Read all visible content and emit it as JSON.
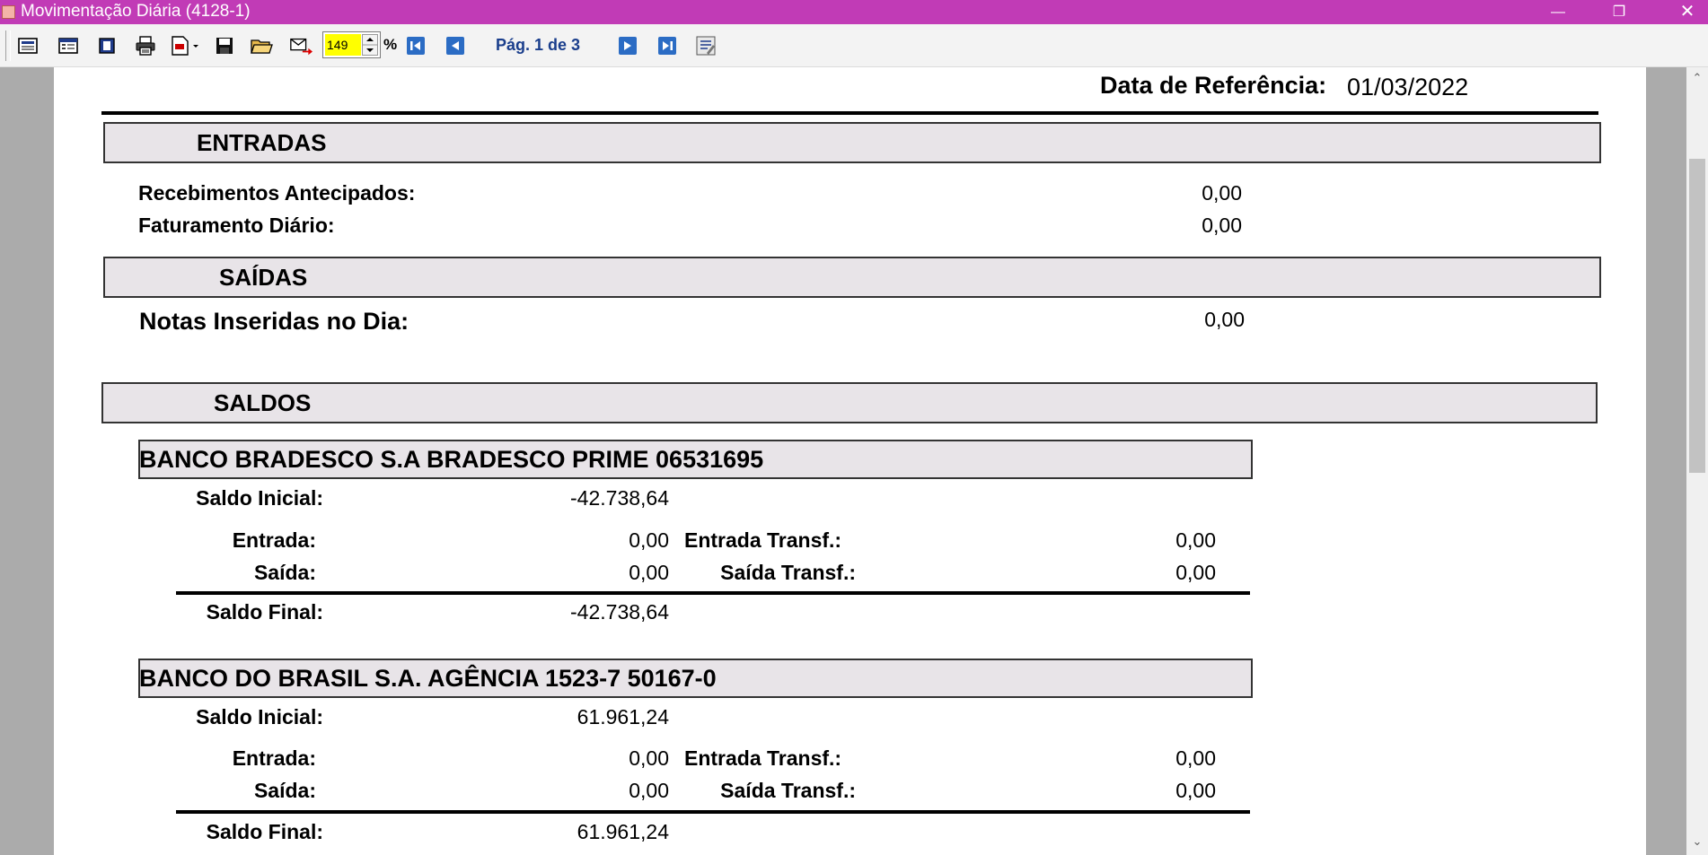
{
  "window": {
    "title": "Movimentação Diária (4128-1)"
  },
  "toolbar": {
    "zoom_value": "149",
    "zoom_unit": "%",
    "page_info": "Pág. 1 de 3"
  },
  "report": {
    "ref_label": "Data de Referência:",
    "ref_date": "01/03/2022",
    "entradas": {
      "title": "ENTRADAS",
      "rows": [
        {
          "label": "Recebimentos Antecipados:",
          "value": "0,00"
        },
        {
          "label": "Faturamento Diário:",
          "value": "0,00"
        }
      ]
    },
    "saidas": {
      "title": "SAÍDAS",
      "rows": [
        {
          "label": "Notas Inseridas no Dia:",
          "value": "0,00"
        }
      ]
    },
    "saldos": {
      "title": "SALDOS",
      "banks": [
        {
          "name": "BANCO BRADESCO S.A BRADESCO PRIME 06531695",
          "saldo_inicial_label": "Saldo Inicial:",
          "saldo_inicial": "-42.738,64",
          "entrada_label": "Entrada:",
          "entrada": "0,00",
          "entrada_transf_label": "Entrada Transf.:",
          "entrada_transf": "0,00",
          "saida_label": "Saída:",
          "saida": "0,00",
          "saida_transf_label": "Saída Transf.:",
          "saida_transf": "0,00",
          "saldo_final_label": "Saldo Final:",
          "saldo_final": "-42.738,64"
        },
        {
          "name": "BANCO DO BRASIL S.A. AGÊNCIA 1523-7 50167-0",
          "saldo_inicial_label": "Saldo Inicial:",
          "saldo_inicial": "61.961,24",
          "entrada_label": "Entrada:",
          "entrada": "0,00",
          "entrada_transf_label": "Entrada Transf.:",
          "entrada_transf": "0,00",
          "saida_label": "Saída:",
          "saida": "0,00",
          "saida_transf_label": "Saída Transf.:",
          "saida_transf": "0,00",
          "saldo_final_label": "Saldo Final:",
          "saldo_final": "61.961,24"
        }
      ]
    }
  }
}
